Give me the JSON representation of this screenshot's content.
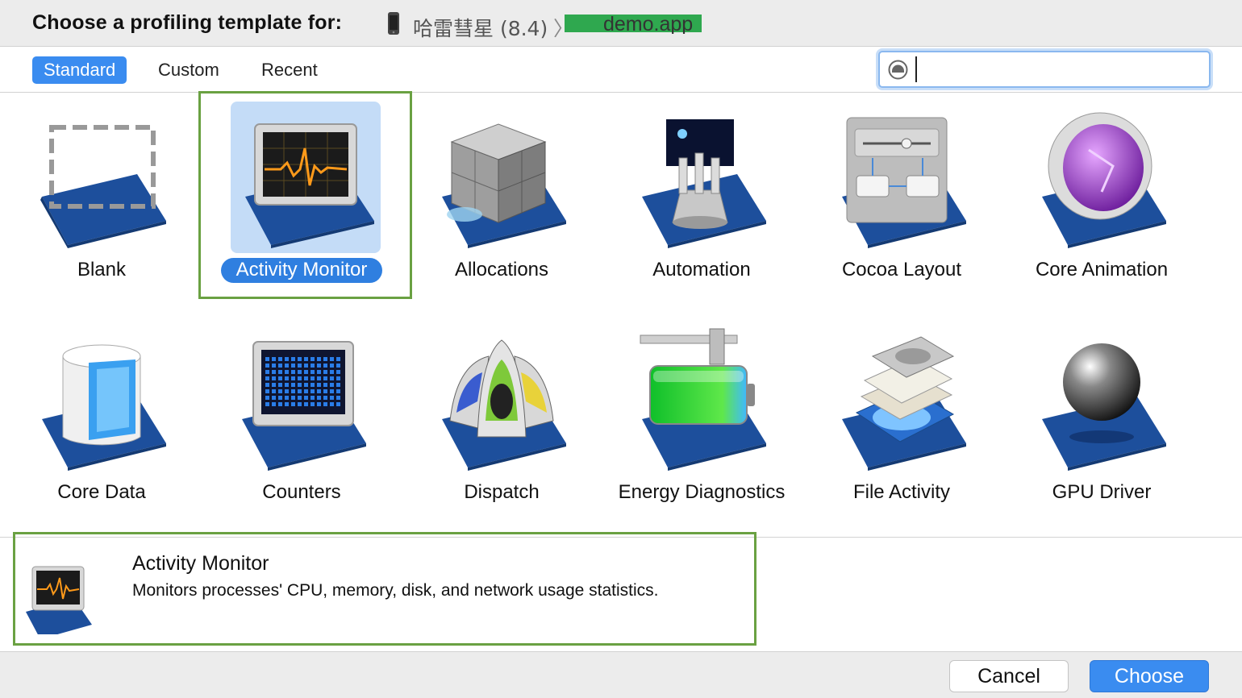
{
  "header": {
    "title": "Choose a profiling template for:",
    "device_name": "哈雷彗星 (8.4)",
    "separator": "〉",
    "app_name": "demo.app"
  },
  "tabs": [
    {
      "label": "Standard",
      "active": true
    },
    {
      "label": "Custom",
      "active": false
    },
    {
      "label": "Recent",
      "active": false
    }
  ],
  "search": {
    "value": "",
    "placeholder": ""
  },
  "templates": [
    {
      "label": "Blank",
      "icon": "blank-icon"
    },
    {
      "label": "Activity Monitor",
      "icon": "activity-monitor-icon",
      "selected": true
    },
    {
      "label": "Allocations",
      "icon": "allocations-icon"
    },
    {
      "label": "Automation",
      "icon": "automation-icon"
    },
    {
      "label": "Cocoa Layout",
      "icon": "cocoa-layout-icon"
    },
    {
      "label": "Core Animation",
      "icon": "core-animation-icon"
    },
    {
      "label": "Core Data",
      "icon": "core-data-icon"
    },
    {
      "label": "Counters",
      "icon": "counters-icon"
    },
    {
      "label": "Dispatch",
      "icon": "dispatch-icon"
    },
    {
      "label": "Energy Diagnostics",
      "icon": "energy-diagnostics-icon"
    },
    {
      "label": "File Activity",
      "icon": "file-activity-icon"
    },
    {
      "label": "GPU Driver",
      "icon": "gpu-driver-icon"
    }
  ],
  "description": {
    "title": "Activity Monitor",
    "text": "Monitors processes' CPU, memory, disk, and network usage statistics."
  },
  "footer": {
    "cancel_label": "Cancel",
    "choose_label": "Choose"
  },
  "colors": {
    "accent": "#3a8cf0",
    "highlight_box": "#6aa142",
    "selection_bg": "#c4dcf7"
  }
}
